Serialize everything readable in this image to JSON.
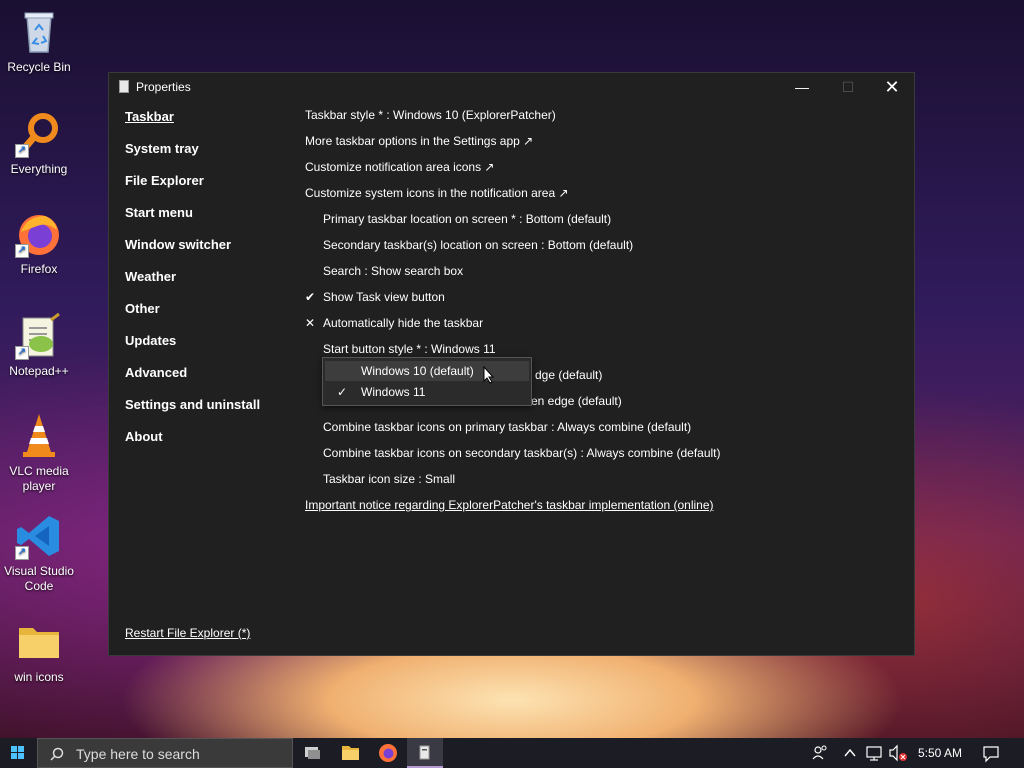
{
  "desktop": {
    "icons": [
      {
        "label": "Recycle Bin",
        "icon": "recycle-bin-icon"
      },
      {
        "label": "Everything",
        "icon": "everything-search-icon"
      },
      {
        "label": "Firefox",
        "icon": "firefox-icon"
      },
      {
        "label": "Notepad++",
        "icon": "notepad-plus-plus-icon"
      },
      {
        "label": "VLC media player",
        "icon": "vlc-cone-icon"
      },
      {
        "label": "Visual Studio Code",
        "icon": "vscode-icon"
      },
      {
        "label": "win icons",
        "icon": "folder-icon"
      }
    ]
  },
  "window": {
    "title": "Properties",
    "controls": {
      "minimize": "—",
      "maximize": "☐",
      "close": "✕"
    },
    "sidebar": {
      "items": [
        {
          "label": "Taskbar",
          "active": true
        },
        {
          "label": "System tray"
        },
        {
          "label": "File Explorer"
        },
        {
          "label": "Start menu"
        },
        {
          "label": "Window switcher"
        },
        {
          "label": "Weather"
        },
        {
          "label": "Other"
        },
        {
          "label": "Updates"
        },
        {
          "label": "Advanced"
        },
        {
          "label": "Settings and uninstall"
        },
        {
          "label": "About"
        }
      ],
      "restart_link": "Restart File Explorer (*)"
    },
    "settings": [
      {
        "text": "Taskbar style * : Windows 10 (ExplorerPatcher)"
      },
      {
        "text": "More taskbar options in the Settings app ↗"
      },
      {
        "text": "Customize notification area icons ↗"
      },
      {
        "text": "Customize system icons in the notification area ↗"
      },
      {
        "text": "Primary taskbar location on screen * : Bottom (default)"
      },
      {
        "text": "Secondary taskbar(s) location on screen : Bottom (default)"
      },
      {
        "text": "Search : Show search box"
      },
      {
        "text": "Show Task view button",
        "mark": "✔"
      },
      {
        "text": "Automatically hide the taskbar",
        "mark": "✕"
      },
      {
        "text": "Start button style * : Windows 11"
      },
      {
        "text": "dge (default)"
      },
      {
        "text": "en edge (default)"
      },
      {
        "text": "Combine taskbar icons on primary taskbar : Always combine (default)"
      },
      {
        "text": "Combine taskbar icons on secondary taskbar(s) : Always combine (default)"
      },
      {
        "text": "Taskbar icon size : Small"
      },
      {
        "text": "Important notice regarding ExplorerPatcher's taskbar implementation (online)"
      }
    ],
    "dropdown": {
      "options": [
        {
          "label": "Windows 10 (default)"
        },
        {
          "label": "Windows 11",
          "checked": "✓"
        }
      ]
    }
  },
  "taskbar": {
    "search_placeholder": "Type here to search",
    "clock": "5:50 AM",
    "apps": [
      "task-view-icon",
      "file-explorer-icon",
      "firefox-icon",
      "properties-window-icon"
    ],
    "tray": [
      "people-icon",
      "chevron-up-icon",
      "network-icon",
      "volume-muted-icon",
      "notification-icon"
    ]
  }
}
